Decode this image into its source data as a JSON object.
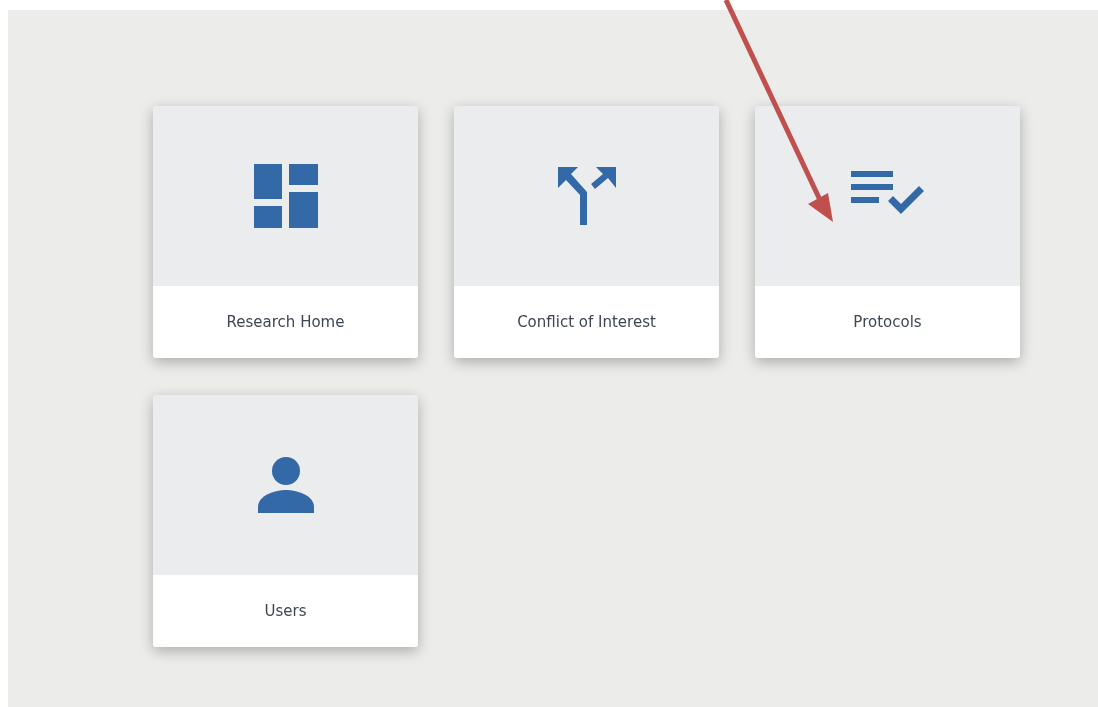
{
  "tiles": [
    {
      "label": "Research Home",
      "kind": "dashboard"
    },
    {
      "label": "Conflict of Interest",
      "kind": "fork"
    },
    {
      "label": "Protocols",
      "kind": "checklist"
    },
    {
      "label": "Users",
      "kind": "person"
    }
  ]
}
